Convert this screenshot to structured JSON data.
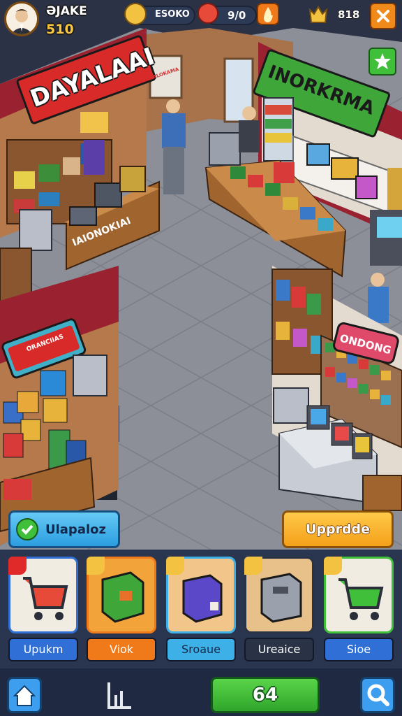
{
  "hud": {
    "player_name": "ƏJAKE",
    "player_level": "510",
    "coins_label": "ESOKO",
    "hearts_label": "9/0",
    "crowns_label": "818"
  },
  "signs": {
    "left_store": "DAYALAAI",
    "right_store": "INORKRMA",
    "counter": "IAIONOKIAI",
    "lower_left": "ORANCIIAS",
    "lower_right": "ONDONG",
    "wall_small": "ALOKAMA"
  },
  "buttons": {
    "left_action": "Ulapaloz",
    "upgrade": "Upprdde",
    "bottom_center": "64"
  },
  "cards": [
    {
      "label": "Upukm",
      "color": "#2f6fd6"
    },
    {
      "label": "Viok",
      "color": "#f07a1a"
    },
    {
      "label": "Sroaue",
      "color": "#3db0e8"
    },
    {
      "label": "Ureaice",
      "color": "#2a3246"
    },
    {
      "label": "Sioe",
      "color": "#2f6fd6"
    }
  ],
  "colors": {
    "floor": "#8a8d96",
    "wall_red": "#9a2230",
    "accent_green": "#3fbf3a",
    "accent_orange": "#f49a1a"
  }
}
